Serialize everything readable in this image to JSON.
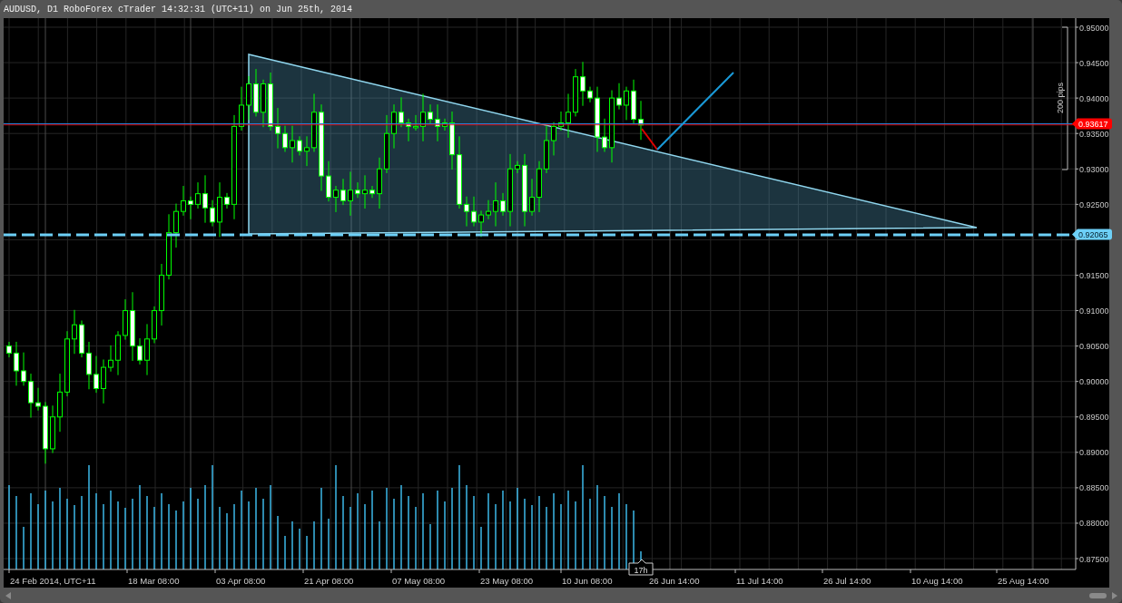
{
  "window": {
    "title": "AUDUSD, D1 RoboForex cTrader 14:32:31 (UTC+11) on Jun 25th, 2014"
  },
  "chart": {
    "price_axis": {
      "labels": [
        "0.95000",
        "0.94500",
        "0.94000",
        "0.93500",
        "0.93000",
        "0.92500",
        "0.91500",
        "0.91000",
        "0.90500",
        "0.90000",
        "0.89500",
        "0.89000",
        "0.88500",
        "0.88000",
        "0.87500"
      ]
    },
    "time_axis": {
      "labels": [
        "24 Feb 2014, UTC+11",
        "18 Mar 08:00",
        "03 Apr 08:00",
        "21 Apr 08:00",
        "07 May 08:00",
        "23 May 08:00",
        "10 Jun 08:00",
        "26 Jun 14:00",
        "11 Jul 14:00",
        "26 Jul 14:00",
        "10 Aug 14:00",
        "25 Aug 14:00"
      ]
    },
    "price_lines": [
      {
        "kind": "current",
        "label": "0.93617",
        "color": "#ff0000"
      },
      {
        "kind": "dashed",
        "label": "0.92065",
        "color": "#6dd0f7"
      }
    ],
    "range_ruler": {
      "label": "200 pips"
    },
    "cursor_tooltip": {
      "label": "17h"
    }
  }
}
